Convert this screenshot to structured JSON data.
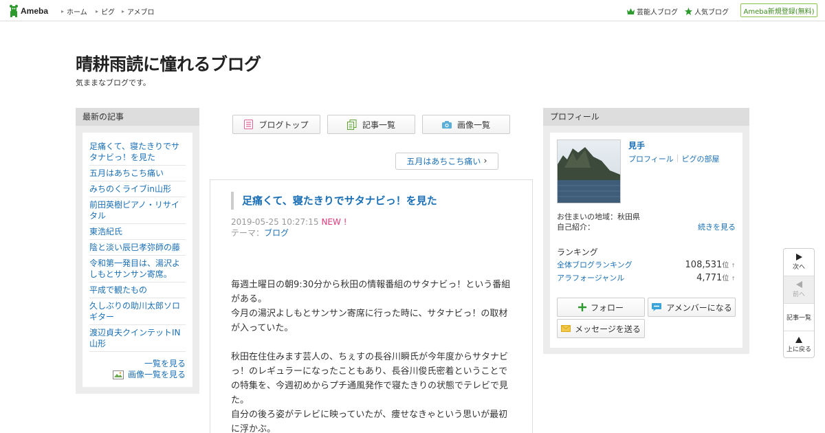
{
  "header": {
    "logo_text": "Ameba",
    "nav": [
      {
        "label": "ホーム"
      },
      {
        "label": "ピグ"
      },
      {
        "label": "アメブロ"
      }
    ],
    "right_links": [
      {
        "label": "芸能人ブログ"
      },
      {
        "label": "人気ブログ"
      }
    ],
    "register_label": "Ameba新規登録(無料)"
  },
  "blog": {
    "title": "晴耕雨読に憧れるブログ",
    "description": "気ままなブログです。"
  },
  "sidebar_left": {
    "heading": "最新の記事",
    "items": [
      {
        "label": "足痛くて、寝たきりでサタナビっ！を見た"
      },
      {
        "label": "五月はあちこち痛い"
      },
      {
        "label": "みちのくライブin山形"
      },
      {
        "label": "前田英樹ピアノ・リサイタル"
      },
      {
        "label": "東浩紀氏"
      },
      {
        "label": "陰と淡い辰巳孝弥師の藤"
      },
      {
        "label": "令和第一発目は、湯沢よしもとサンサン寄席。"
      },
      {
        "label": "平成で観たもの"
      },
      {
        "label": "久しぶりの助川太郎ソロギター"
      },
      {
        "label": "渡辺貞夫クインテットIN山形"
      }
    ],
    "see_all": "一覧を見る",
    "see_images": "画像一覧を見る"
  },
  "toolbar": {
    "blog_top": "ブログトップ",
    "article_list": "記事一覧",
    "image_list": "画像一覧"
  },
  "next_article": "五月はあちこち痛い",
  "article": {
    "title": "足痛くて、寝たきりでサタナビっ！を見た",
    "date": "2019-05-25 10:27:15",
    "new_badge": "NEW !",
    "theme_label": "テーマ：",
    "theme": "ブログ",
    "paragraphs": [
      "毎週土曜日の朝9:30分から秋田の情報番組のサタナビっ！という番組がある。",
      "今月の湯沢よしもとサンサン寄席に行った時に、サタナビっ！の取材が入っていた。",
      "",
      "秋田在住住みます芸人の、ちぇすの長谷川瞬氏が今年度からサタナビっ！のレギュラーになったこともあり、長谷川俊氏密着ということでの特集を、今週初めからプチ通風発作で寝たきりの状態でテレビで見た。",
      "自分の後ろ姿がテレビに映っていたが、痩せなきゃという思いが最初に浮かぶ。"
    ]
  },
  "profile": {
    "heading": "プロフィール",
    "name": "見手",
    "link_profile": "プロフィール",
    "link_room": "ピグの部屋",
    "area": "お住まいの地域：秋田県",
    "intro_label": "自己紹介：",
    "continue": "続きを見る",
    "ranking_heading": "ランキング",
    "ranking": [
      {
        "label": "全体ブログランキング",
        "value": "108,531",
        "unit": "位",
        "arrow": "↑"
      },
      {
        "label": "アラフォージャンル",
        "value": "4,771",
        "unit": "位",
        "arrow": "↑"
      }
    ],
    "follow": "フォロー",
    "amember": "アメンバーになる",
    "message": "メッセージを送る"
  },
  "float_nav": {
    "next": "次へ",
    "prev": "前へ",
    "list": "記事一覧",
    "top": "上に戻る"
  },
  "colors": {
    "link": "#1a6fb5",
    "new_badge": "#e5387a",
    "register_border": "#8bc34a",
    "brand_green": "#2d9a2d"
  }
}
